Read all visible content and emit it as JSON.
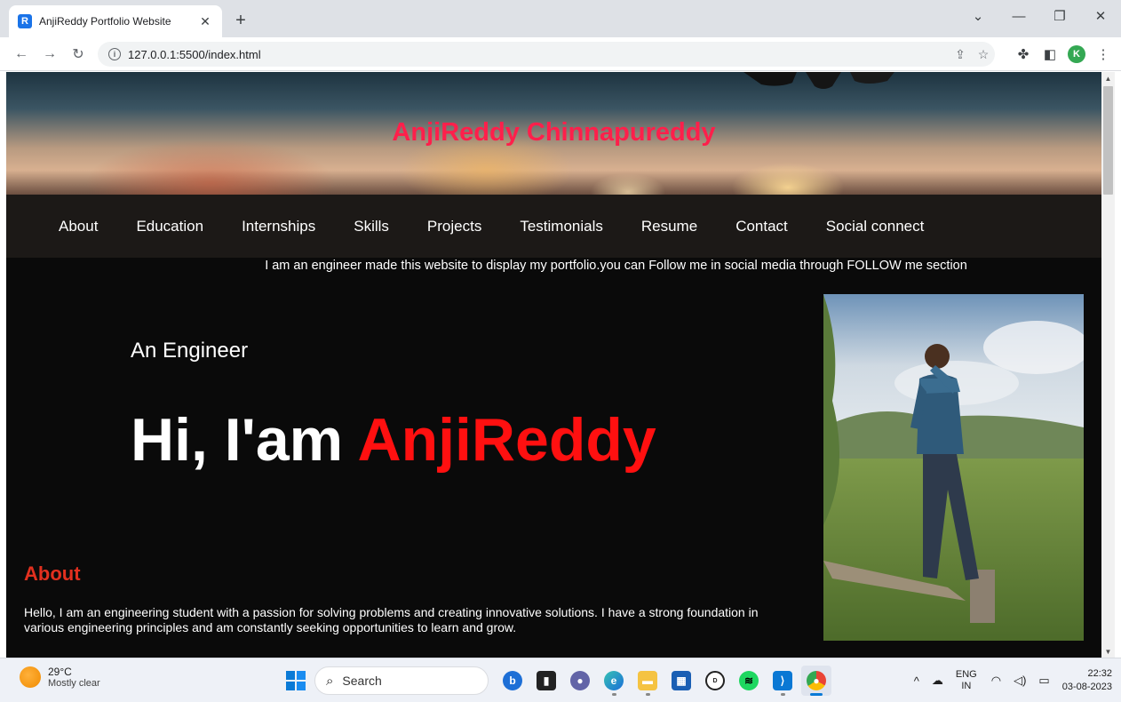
{
  "browser": {
    "tab_title": "AnjiReddy Portfolio Website",
    "favicon_letter": "R",
    "url": "127.0.0.1:5500/index.html",
    "profile_letter": "K"
  },
  "page": {
    "hero_title": "AnjiReddy Chinnapureddy",
    "nav": [
      "About",
      "Education",
      "Internships",
      "Skills",
      "Projects",
      "Testimonials",
      "Resume",
      "Contact",
      "Social connect"
    ],
    "intro": "I am an engineer made this website to display my portfolio.you can Follow me in social media through FOLLOW me section",
    "subtitle": "An Engineer",
    "greeting_prefix": "Hi, I'am ",
    "greeting_name": "AnjiReddy",
    "about_heading": "About",
    "about_text": "Hello, I am an engineering student with a passion for solving problems and creating innovative solutions. I have a strong foundation in various engineering principles and am constantly seeking opportunities to learn and grow."
  },
  "taskbar": {
    "temperature": "29°C",
    "weather": "Mostly clear",
    "search_label": "Search",
    "lang_top": "ENG",
    "lang_bottom": "IN",
    "time": "22:32",
    "date": "03-08-2023"
  },
  "colors": {
    "hero_title": "#ff1f4b",
    "greeting_name": "#ff1010",
    "about_heading": "#e2301f",
    "navbar_bg": "#1c1917",
    "page_bg": "#0a0a0a"
  }
}
